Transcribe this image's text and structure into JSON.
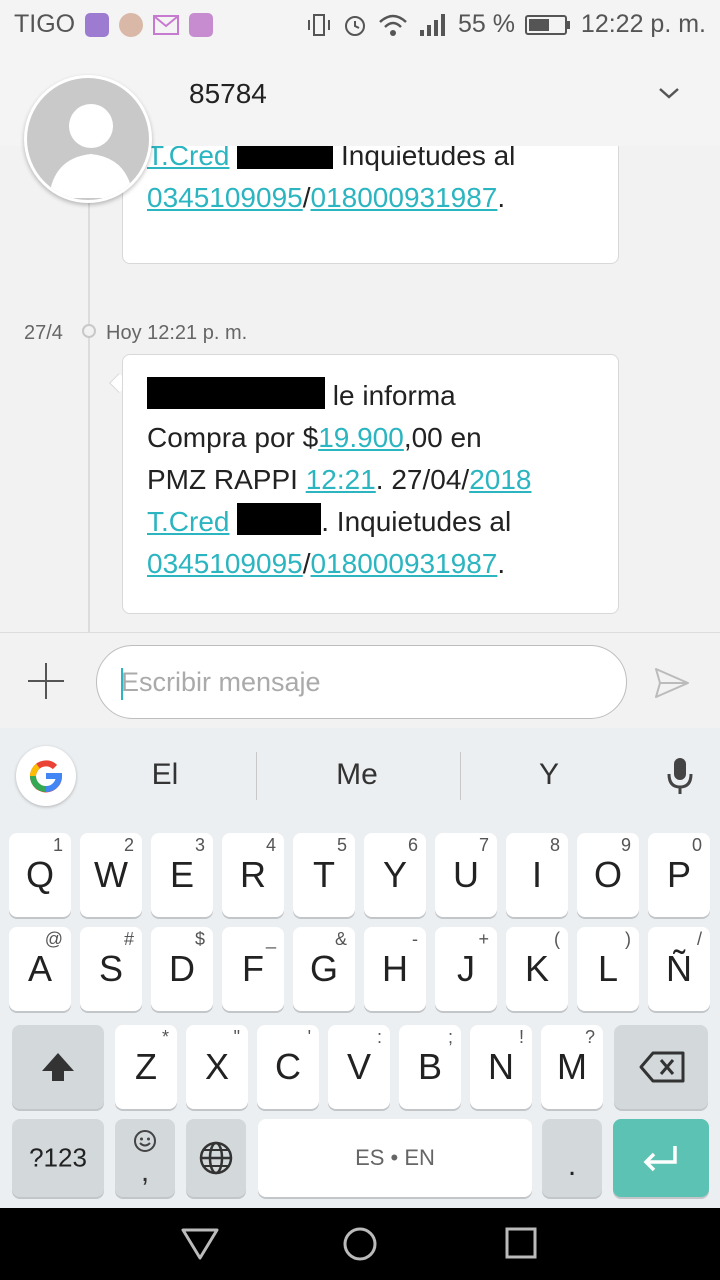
{
  "status_bar": {
    "carrier": "TIGO",
    "battery": "55 %",
    "time": "12:22 p. m."
  },
  "header": {
    "title": "85784"
  },
  "messages": {
    "m1": {
      "line1": "T.Cred",
      "line1_tail": " Inquietudes al",
      "line2_a": "0345109095",
      "line2_sep": "/",
      "line2_b": "018000931987",
      "line2_end": "."
    },
    "date": "27/4",
    "timestamp": "Hoy 12:21 p. m.",
    "m2": {
      "l1": "le informa",
      "l2_a": "Compra por $",
      "l2_amt": "19.900",
      "l2_b": ",00 en",
      "l3_a": "PMZ RAPPI ",
      "l3_time": "12:21",
      "l3_b": ". 27/04/",
      "l3_year": "2018",
      "l4_a": "T.Cred",
      "l4_b": ". Inquietudes al",
      "l5_a": "0345109095",
      "l5_sep": "/",
      "l5_b": "018000931987",
      "l5_end": "."
    }
  },
  "compose": {
    "placeholder": "Escribir mensaje"
  },
  "keyboard": {
    "suggestions": [
      "El",
      "Me",
      "Y"
    ],
    "row1": [
      [
        "Q",
        "1"
      ],
      [
        "W",
        "2"
      ],
      [
        "E",
        "3"
      ],
      [
        "R",
        "4"
      ],
      [
        "T",
        "5"
      ],
      [
        "Y",
        "6"
      ],
      [
        "U",
        "7"
      ],
      [
        "I",
        "8"
      ],
      [
        "O",
        "9"
      ],
      [
        "P",
        "0"
      ]
    ],
    "row2": [
      [
        "A",
        "@"
      ],
      [
        "S",
        "#"
      ],
      [
        "D",
        "$"
      ],
      [
        "F",
        "_"
      ],
      [
        "G",
        "&"
      ],
      [
        "H",
        "-"
      ],
      [
        "J",
        "+"
      ],
      [
        "K",
        "("
      ],
      [
        "L",
        ")"
      ],
      [
        "Ñ",
        "/"
      ]
    ],
    "row3": [
      [
        "Z",
        "*"
      ],
      [
        "X",
        "\""
      ],
      [
        "C",
        "'"
      ],
      [
        "V",
        ":"
      ],
      [
        "B",
        ";"
      ],
      [
        "N",
        "!"
      ],
      [
        "M",
        "?"
      ]
    ],
    "sym_key": "?123",
    "comma_key": ",",
    "space_key": "ES • EN",
    "period_key": "."
  },
  "colors": {
    "link": "#2bb5c0",
    "enter": "#5cc2b4"
  }
}
